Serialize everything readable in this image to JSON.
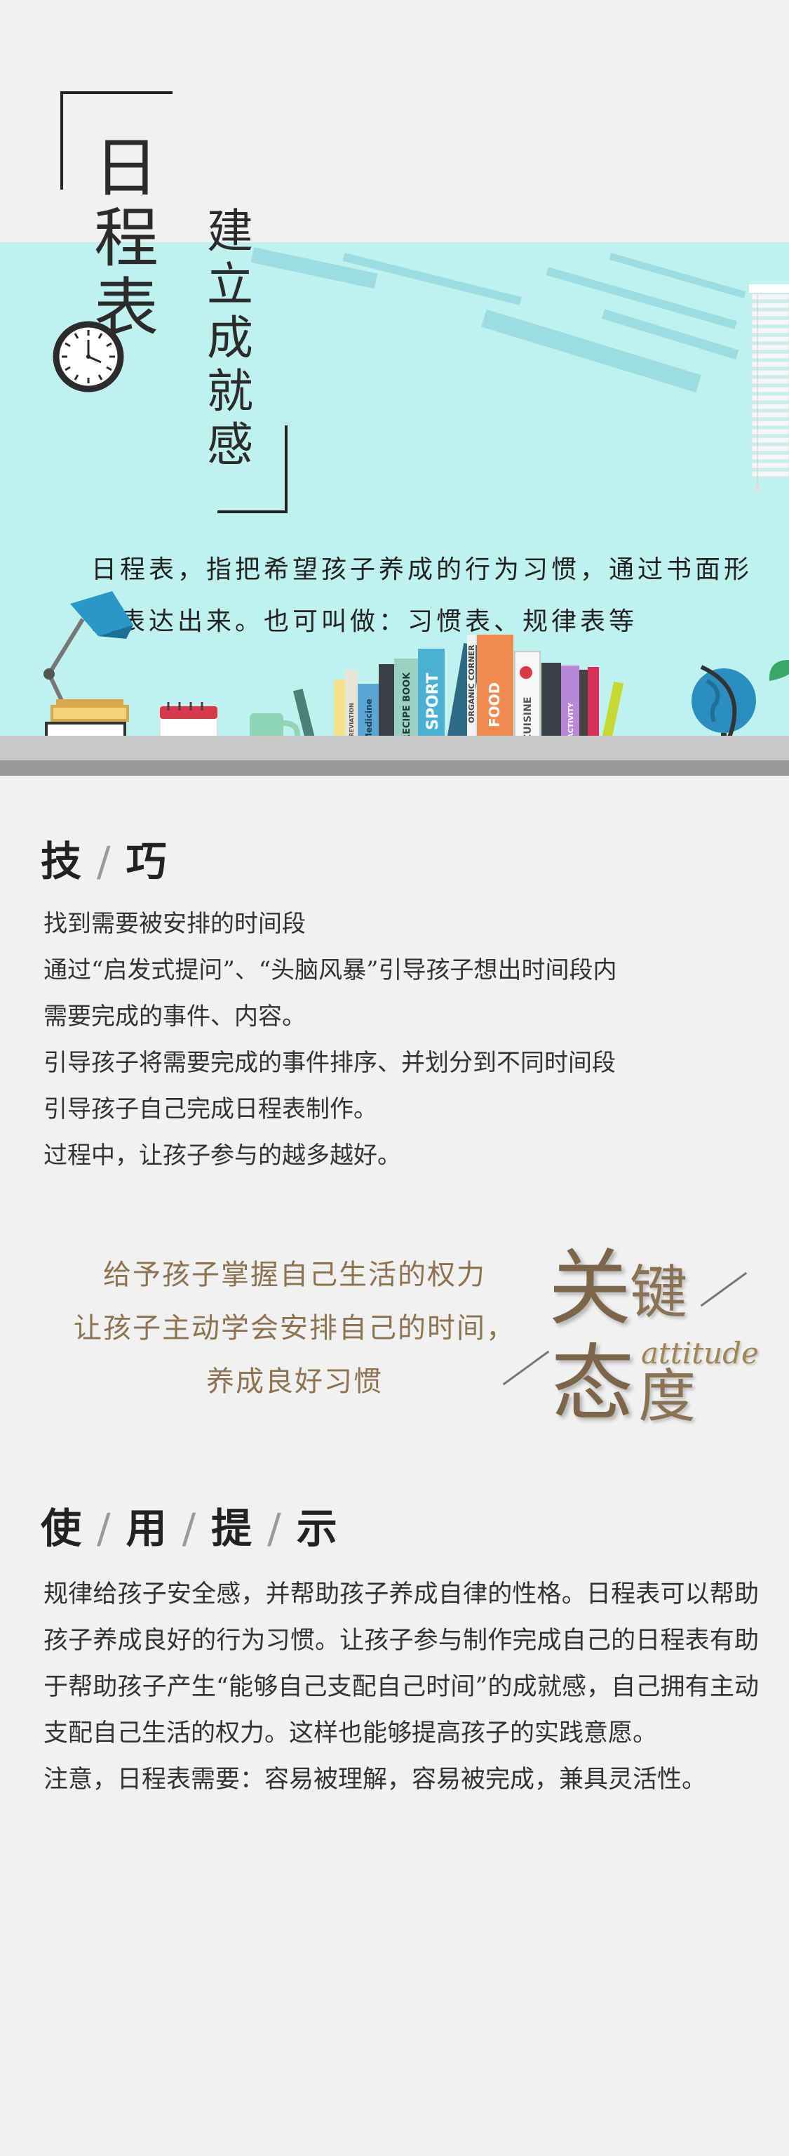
{
  "hero": {
    "title_chars": [
      "日",
      "程",
      "表"
    ],
    "subtitle_chars": [
      "建",
      "立",
      "成",
      "就",
      "感"
    ],
    "intro_line1": "日程表，指把希望孩子养成的行为习惯，通过书面形",
    "intro_line2": "式表达出来。也可叫做：习惯表、规律表等",
    "book_spines": {
      "b1": "ABBREVIATION",
      "b2": "Medicine",
      "b3": "RECIPE BOOK",
      "b4": "SPORT",
      "b5": "ORGANIC CORNER",
      "b6": "FOOD",
      "b7": "CUISINE",
      "b8": "ACTIVITY"
    },
    "colors": {
      "sky": "#bff2ee",
      "streak": "#8fd6dc",
      "globe": "#2a8fc0",
      "lamp": "#2b97c8"
    }
  },
  "tips": {
    "title_a": "技",
    "title_b": "巧",
    "lines": [
      "找到需要被安排的时间段",
      "通过“启发式提问”、“头脑风暴”引导孩子想出时间段内",
      "需要完成的事件、内容。",
      "引导孩子将需要完成的事件排序、并划分到不同时间段",
      "引导孩子自己完成日程表制作。",
      "过程中，让孩子参与的越多越好。"
    ]
  },
  "quote": {
    "lines": [
      "给予孩子掌握自己生活的权力",
      "让孩子主动学会安排自己的时间，",
      "养成良好习惯"
    ],
    "key_1": "关",
    "key_2": "键",
    "key_3": "态",
    "key_4": "度",
    "attitude": "attitude",
    "color": "#8e7350"
  },
  "usage": {
    "title_chars": [
      "使",
      "用",
      "提",
      "示"
    ],
    "paragraph": "规律给孩子安全感，并帮助孩子养成自律的性格。日程表可以帮助孩子养成良好的行为习惯。让孩子参与制作完成自己的日程表有助于帮助孩子产生“能够自己支配自己时间”的成就感，自己拥有主动支配自己生活的权力。这样也能够提高孩子的实践意愿。",
    "note": "注意，日程表需要：容易被理解，容易被完成，兼具灵活性。"
  }
}
